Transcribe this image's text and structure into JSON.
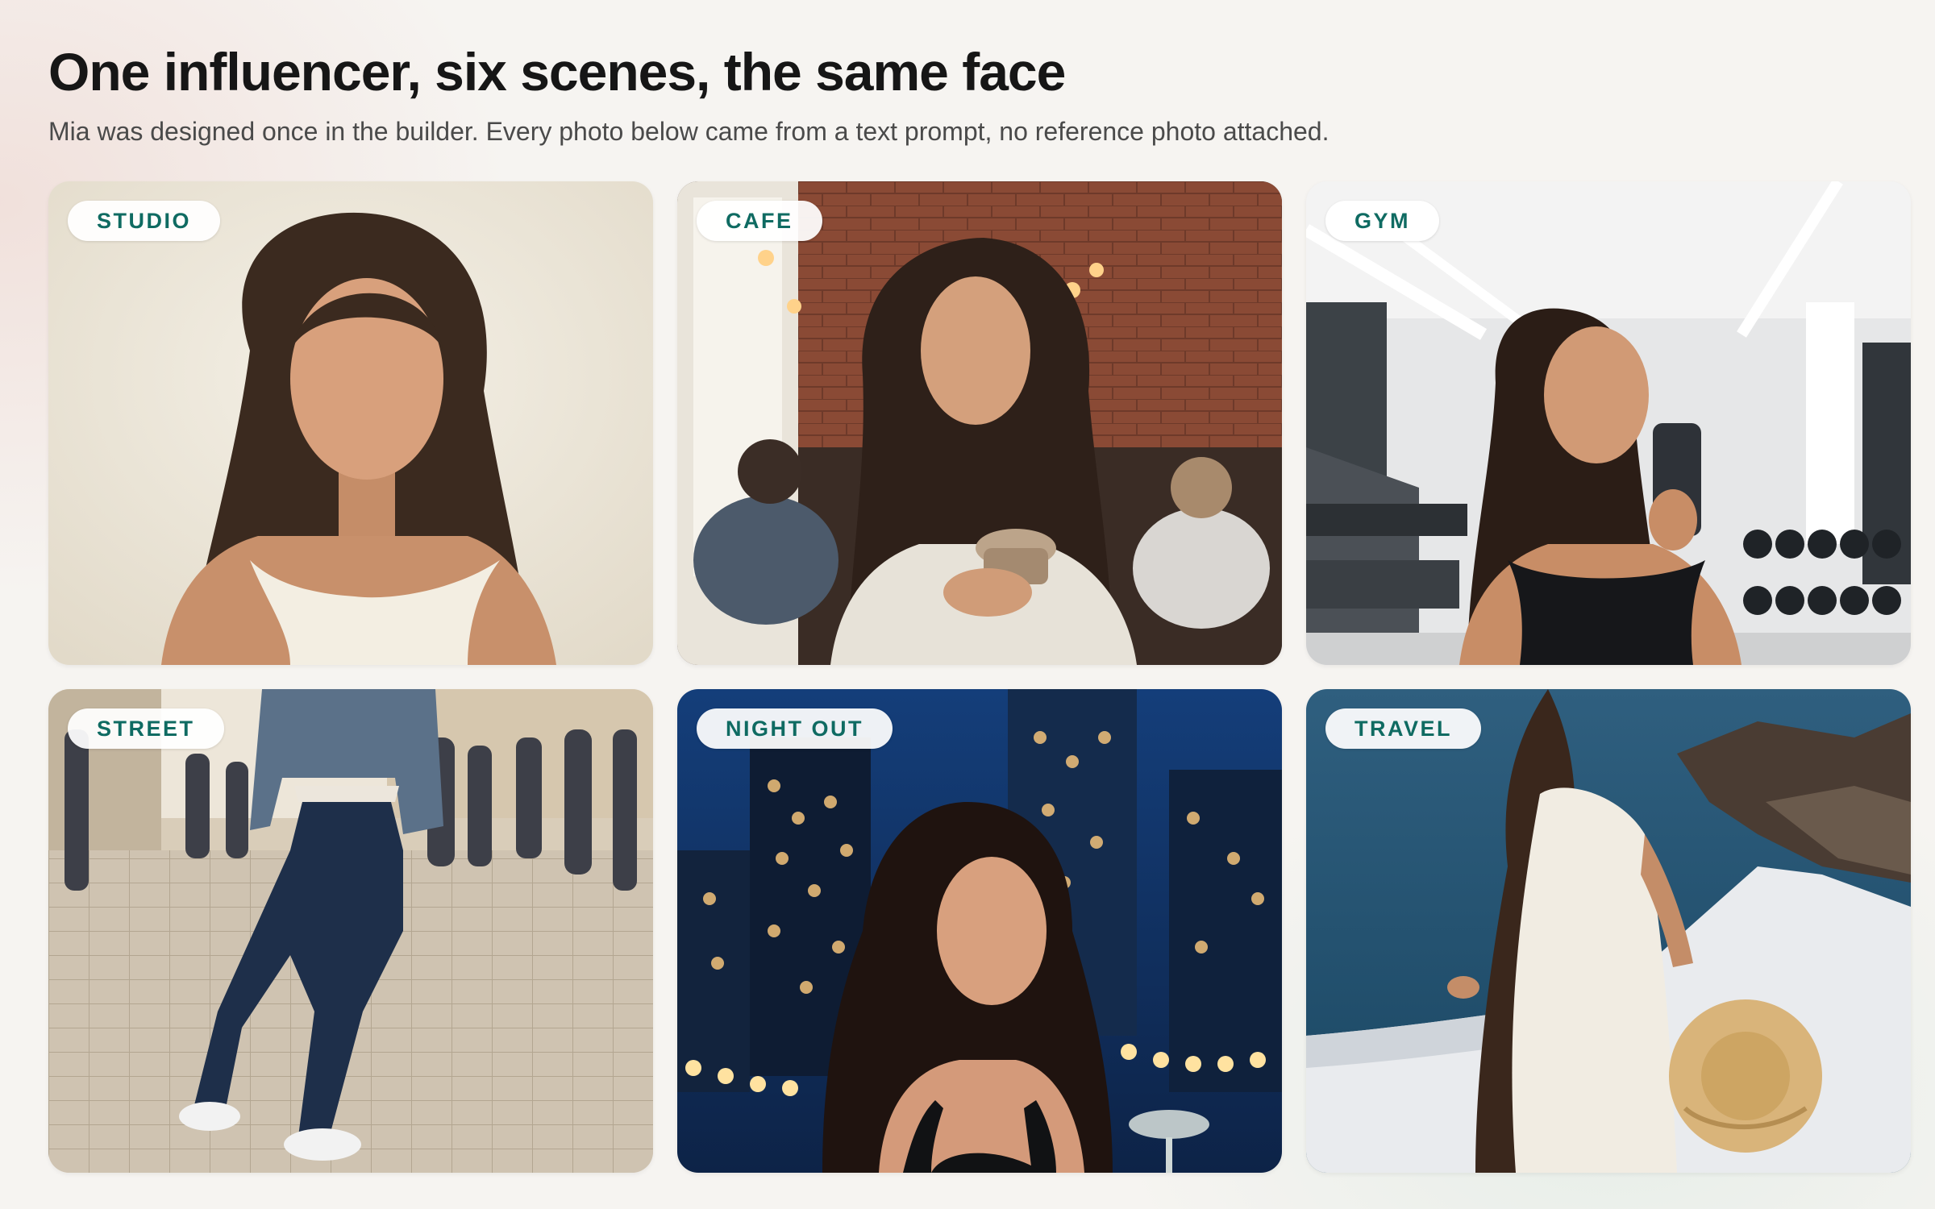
{
  "header": {
    "title": "One influencer, six scenes, the same face",
    "subtitle": "Mia was designed once in the builder. Every photo below came from a text prompt, no reference photo attached."
  },
  "cards": [
    {
      "label": "STUDIO"
    },
    {
      "label": "CAFE"
    },
    {
      "label": "GYM"
    },
    {
      "label": "STREET"
    },
    {
      "label": "NIGHT OUT"
    },
    {
      "label": "TRAVEL"
    }
  ],
  "colors": {
    "tag_text": "#0f6b62",
    "tag_background": "#ffffff",
    "page_background": "#f6f4f1"
  }
}
